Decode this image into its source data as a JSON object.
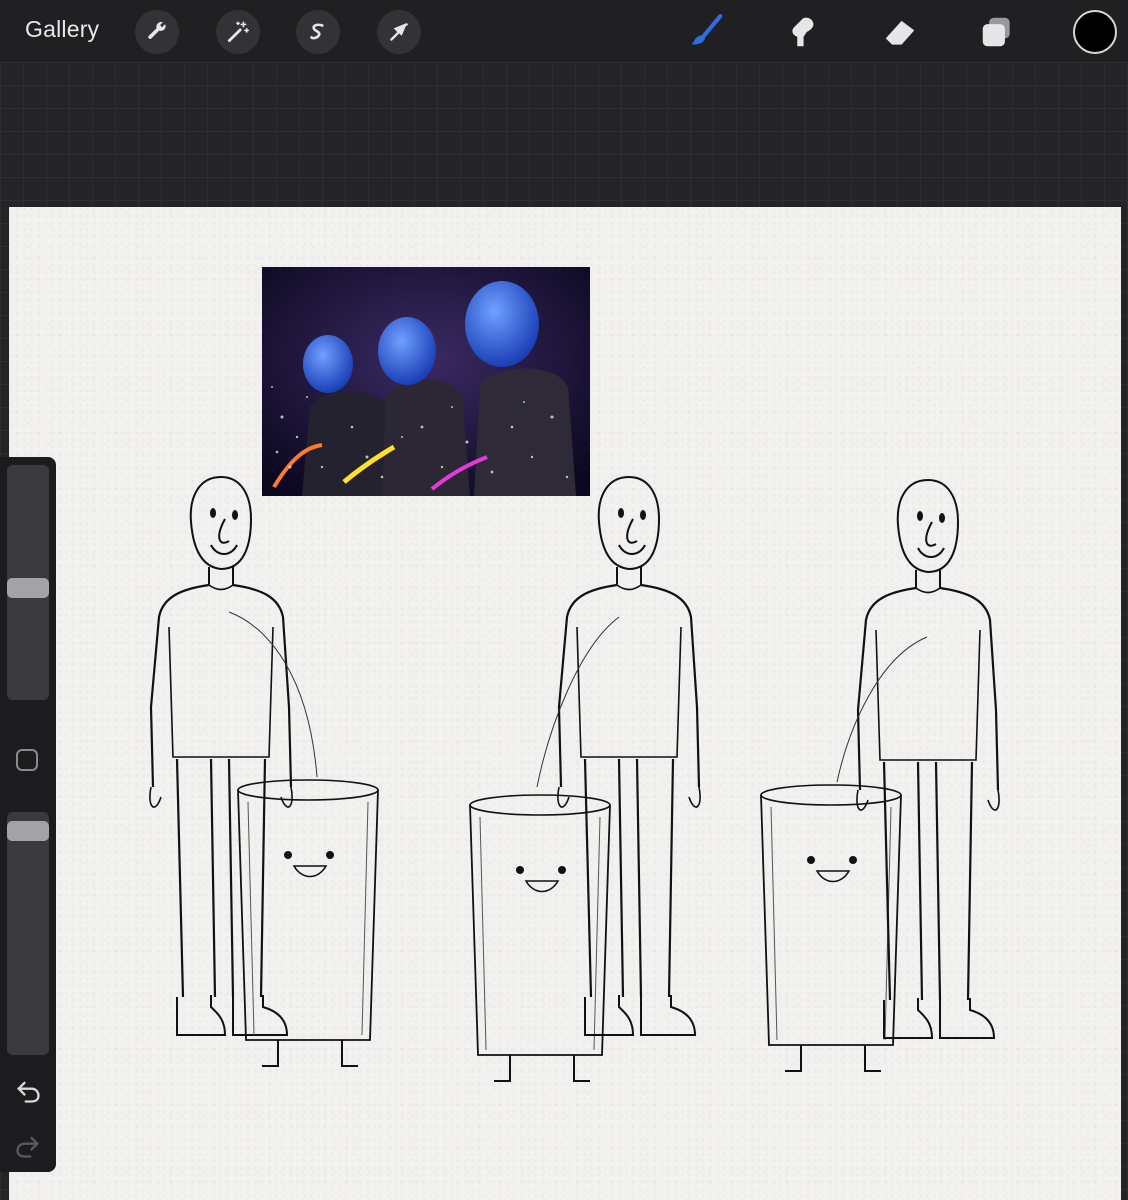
{
  "toolbar": {
    "gallery_label": "Gallery",
    "left_tools": [
      "wrench-icon",
      "magic-wand-icon",
      "selection-s-icon",
      "arrow-cursor-icon"
    ],
    "right_tools": [
      "brush-icon",
      "smudge-icon",
      "eraser-icon",
      "layers-icon"
    ],
    "active_tool": "brush-icon",
    "accent_color": "#2f6de6",
    "current_color": "#000000"
  },
  "sidebar": {
    "brush_size_level": 0.55,
    "brush_opacity_level": 0.9,
    "tools": [
      "modify-square-icon",
      "undo-icon",
      "redo-icon"
    ]
  },
  "canvas": {
    "background_color": "#f2f1ef",
    "reference_image": "three-blue-performers-photo",
    "drawing": "three-bald-men-with-smiling-trash-cans"
  }
}
